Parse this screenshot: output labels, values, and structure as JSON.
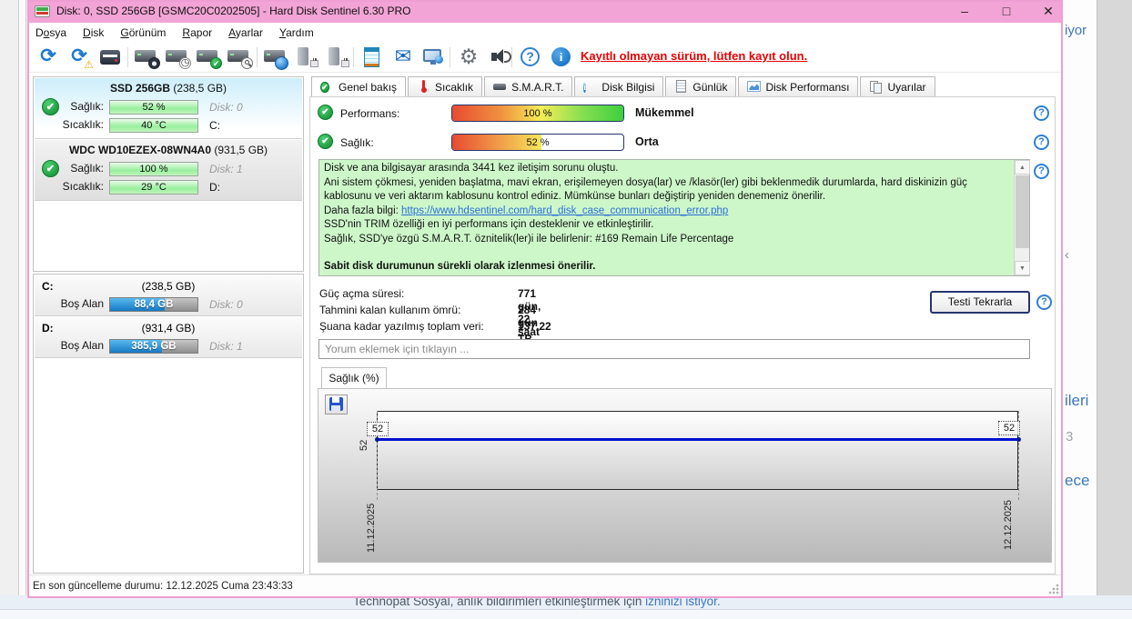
{
  "window": {
    "title": "Disk: 0, SSD 256GB [GSMC20C0202505]  -  Hard Disk Sentinel 6.30 PRO",
    "controls": {
      "minimize": "–",
      "maximize": "□",
      "close": "✕"
    }
  },
  "icons": {
    "check": "✔",
    "warning": "⚠",
    "question": "?",
    "info": "i",
    "refresh": "⟳",
    "scroll_up": "▲",
    "scroll_down": "▼",
    "envelope": "✉",
    "gear": "⚙",
    "clock": "◷",
    "chevron": "‹"
  },
  "menu": {
    "items": [
      {
        "pre": "D",
        "key": "o",
        "post": "sya"
      },
      {
        "pre": "",
        "key": "D",
        "post": "isk"
      },
      {
        "pre": "",
        "key": "G",
        "post": "örünüm"
      },
      {
        "pre": "",
        "key": "R",
        "post": "apor"
      },
      {
        "pre": "",
        "key": "A",
        "post": "yarlar"
      },
      {
        "pre": "",
        "key": "Y",
        "post": "ardım"
      }
    ]
  },
  "toolbar": {
    "register_notice": "Kayıtlı olmayan sürüm, lütfen kayıt olun.",
    "icons": [
      "refresh",
      "refresh-warning",
      "report",
      "disk-gauge",
      "disk-clock",
      "disk-check",
      "disk-search",
      "globe-disk",
      "disk-eject",
      "disk-connect",
      "notes",
      "mail",
      "remote-computer",
      "settings",
      "sounds",
      "help",
      "info"
    ]
  },
  "sidebar": {
    "disks": [
      {
        "name": "SSD 256GB",
        "size": " (238,5 GB)",
        "health_label": "Sağlık:",
        "health": "52 %",
        "disk_ref": "Disk: 0",
        "temp_label": "Sıcaklık:",
        "temp": "40 °C",
        "drive": "C:"
      },
      {
        "name": "WDC WD10EZEX-08WN4A0",
        "size": " (931,5 GB)",
        "health_label": "Sağlık:",
        "health": "100 %",
        "disk_ref": "Disk: 1",
        "temp_label": "Sıcaklık:",
        "temp": "29 °C",
        "drive": "D:"
      }
    ],
    "partitions": [
      {
        "letter": "C:",
        "size": "(238,5 GB)",
        "free_label": "Boş Alan",
        "free": "88,4 GB",
        "disk_ref": "Disk: 0",
        "used_pct": 63
      },
      {
        "letter": "D:",
        "size": "(931,4 GB)",
        "free_label": "Boş Alan",
        "free": "385,9 GB",
        "disk_ref": "Disk: 1",
        "used_pct": 59
      }
    ]
  },
  "tabs": [
    {
      "label": "Genel bakış"
    },
    {
      "label": "Sıcaklık"
    },
    {
      "label": "S.M.A.R.T."
    },
    {
      "label": "Disk Bilgisi"
    },
    {
      "label": "Günlük"
    },
    {
      "label": "Disk Performansı"
    },
    {
      "label": "Uyarılar"
    }
  ],
  "overview": {
    "performance": {
      "label": "Performans:",
      "value": "100 %",
      "status": "Mükemmel",
      "pct": 100
    },
    "health": {
      "label": "Sağlık:",
      "value": "52 %",
      "status": "Orta",
      "pct": 52
    },
    "message": {
      "line1": "Disk ve ana bilgisayar arasında 3441 kez iletişim sorunu oluştu.",
      "line2": "Ani sistem çökmesi, yeniden başlatma, mavi ekran, erişilemeyen dosya(lar) ve /klasör(ler) gibi beklenmedik durumlarda, hard diskinizin güç kablosunu ve veri aktarım kablosunu kontrol ediniz. Mümkünse bunları değiştirip yeniden denemeniz önerilir.",
      "more_info_prefix": "Daha fazla bilgi: ",
      "more_info_link": "https://www.hdsentinel.com/hard_disk_case_communication_error.php",
      "line4": "SSD'nin TRIM özelliği en iyi performans için desteklenir ve etkinleştirilir.",
      "line5": "Sağlık, SSD'ye özgü S.M.A.R.T. öznitelik(ler)i ile belirlenir:  #169 Remain Life Percentage",
      "line6": "Sabit disk durumunun sürekli olarak izlenmesi önerilir."
    },
    "stats": [
      {
        "label": "Güç açma süresi:",
        "value": "771 gün, 22 saat"
      },
      {
        "label": "Tahmini kalan kullanım ömrü:",
        "value": "284 gün"
      },
      {
        "label": "Şuana kadar yazılmış toplam veri:",
        "value": "137,22 TB"
      }
    ],
    "retest_button": "Testi Tekrarla",
    "comment_placeholder": "Yorum eklemek için tıklayın ..."
  },
  "chart_data": {
    "type": "line",
    "title": "Sağlık (%)",
    "x": [
      "11.12.2025",
      "12.12.2025"
    ],
    "series": [
      {
        "name": "Sağlık (%)",
        "values": [
          52,
          52
        ]
      }
    ],
    "point_labels": [
      "52",
      "52"
    ],
    "ytick": "52",
    "line_color": "#0010d0",
    "grid": "dashed vertical lines at data points",
    "legend": "none"
  },
  "status_bar": {
    "text": "En son güncelleme durumu: 12.12.2025 Cuma 23:43:33"
  },
  "background": {
    "fragment_top": "iyor",
    "fragment_chevron": "‹",
    "fragment_1": "ileri",
    "fragment_2": "3",
    "fragment_3": "ece",
    "bottom_text": "Technopat Sosyal, anlık bildirimleri etkinleştirmek için ",
    "bottom_link": "izninizi istiyor."
  }
}
